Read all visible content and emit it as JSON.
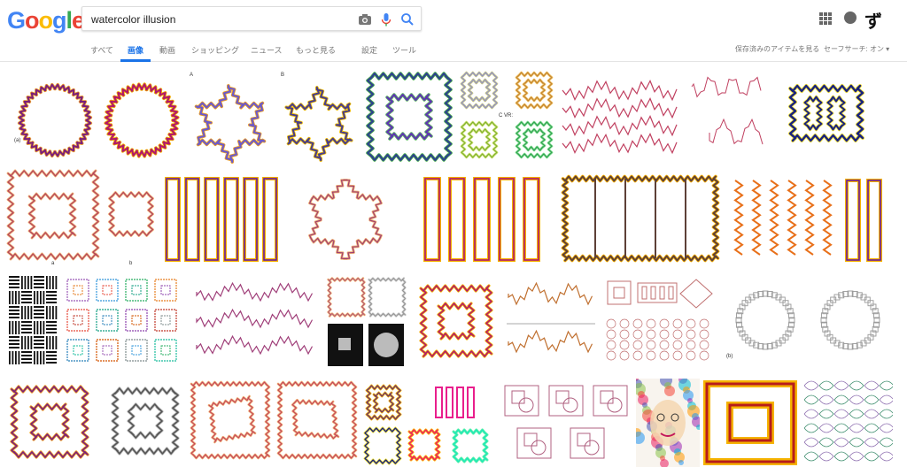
{
  "logo": {
    "letters": [
      "G",
      "o",
      "o",
      "g",
      "l",
      "e"
    ],
    "colors": [
      "#4285f4",
      "#ea4335",
      "#fbbc05",
      "#4285f4",
      "#34a853",
      "#ea4335"
    ]
  },
  "search": {
    "query": "watercolor illusion"
  },
  "icons": {
    "camera": "camera-icon",
    "mic": "mic-icon",
    "search": "search-icon",
    "apps": "apps-grid-icon",
    "notifications": "notifications-icon"
  },
  "account": {
    "avatar_text": "ず"
  },
  "tabs": [
    "すべて",
    "画像",
    "動画",
    "ショッピング",
    "ニュース",
    "もっと見る",
    "設定",
    "ツール"
  ],
  "active_tab": "画像",
  "right_tools": {
    "saved": "保存済みのアイテムを見る",
    "safesearch": "セーフサーチ: オン ▾"
  },
  "colors": {
    "accent": "#1a73e8",
    "text_secondary": "#777777"
  },
  "captions": {
    "a": "a",
    "b": "b",
    "A": "A",
    "B": "B",
    "c_small": "(a)",
    "cvr": "C VR:",
    "panel_b": "(b)"
  }
}
